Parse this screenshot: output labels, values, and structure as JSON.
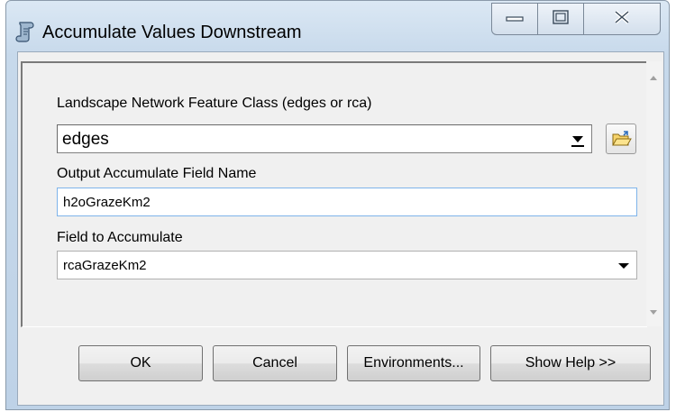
{
  "window": {
    "title": "Accumulate Values Downstream",
    "icon": "script-scroll-icon"
  },
  "titlebar_buttons": [
    "minimize-icon",
    "maximize-icon",
    "close-icon"
  ],
  "form": {
    "network_label": "Landscape Network Feature Class (edges or rca)",
    "network_value": "edges",
    "output_label": "Output Accumulate Field Name",
    "output_value": "h2oGrazeKm2",
    "accumulate_label": "Field to Accumulate",
    "accumulate_value": "rcaGrazeKm2"
  },
  "buttons": {
    "ok": "OK",
    "cancel": "Cancel",
    "environments": "Environments...",
    "help": "Show Help >>"
  }
}
